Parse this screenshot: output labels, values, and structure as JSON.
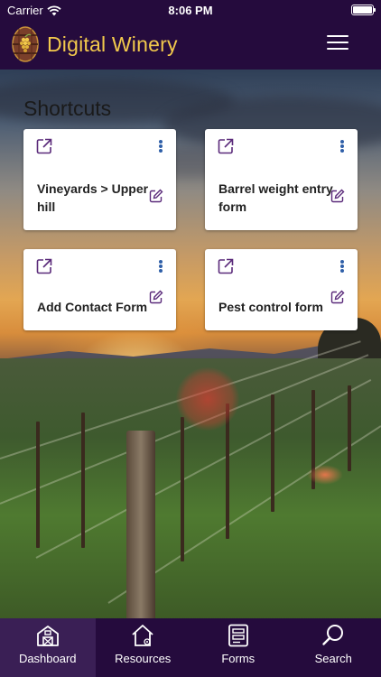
{
  "status_bar": {
    "carrier": "Carrier",
    "time": "8:06 PM"
  },
  "header": {
    "app_title": "Digital Winery",
    "logo_icon": "wine-barrel-icon",
    "menu_icon": "hamburger-menu-icon"
  },
  "shortcuts": {
    "title": "Shortcuts",
    "cards": [
      {
        "label": "Vineyards > Upper hill"
      },
      {
        "label": "Barrel weight entry form"
      },
      {
        "label": "Add Contact Form"
      },
      {
        "label": "Pest control form"
      }
    ]
  },
  "tabs": [
    {
      "label": "Dashboard",
      "icon": "barn-icon"
    },
    {
      "label": "Resources",
      "icon": "house-icon"
    },
    {
      "label": "Forms",
      "icon": "form-icon"
    },
    {
      "label": "Search",
      "icon": "search-icon"
    }
  ],
  "colors": {
    "header_bg": "#250b3d",
    "title_accent": "#f2c94c",
    "icon_purple": "#5a2a7a",
    "kebab_blue": "#2f5fa8"
  }
}
